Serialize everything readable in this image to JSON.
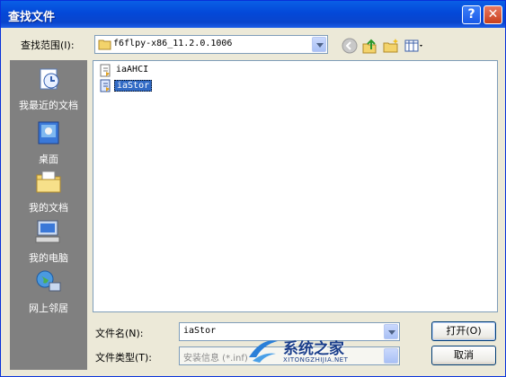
{
  "window": {
    "title": "查找文件"
  },
  "lookin": {
    "label": "查找范围(I):",
    "value": "f6flpy-x86_11.2.0.1006"
  },
  "places": [
    {
      "label": "我最近的文档"
    },
    {
      "label": "桌面"
    },
    {
      "label": "我的文档"
    },
    {
      "label": "我的电脑"
    },
    {
      "label": "网上邻居"
    }
  ],
  "files": [
    {
      "name": "iaAHCI",
      "selected": false
    },
    {
      "name": "iaStor",
      "selected": true
    }
  ],
  "filename": {
    "label": "文件名(N):",
    "value": "iaStor"
  },
  "filetype": {
    "label": "文件类型(T):",
    "value": "安装信息 (*.inf)"
  },
  "buttons": {
    "open": "打开(O)",
    "cancel": "取消"
  },
  "watermark": {
    "text": "系统之家",
    "url": "XITONGZHIJIA.NET"
  },
  "colors": {
    "titlebar": "#0348d8",
    "selection": "#316ac5",
    "places_bg": "#808080"
  }
}
